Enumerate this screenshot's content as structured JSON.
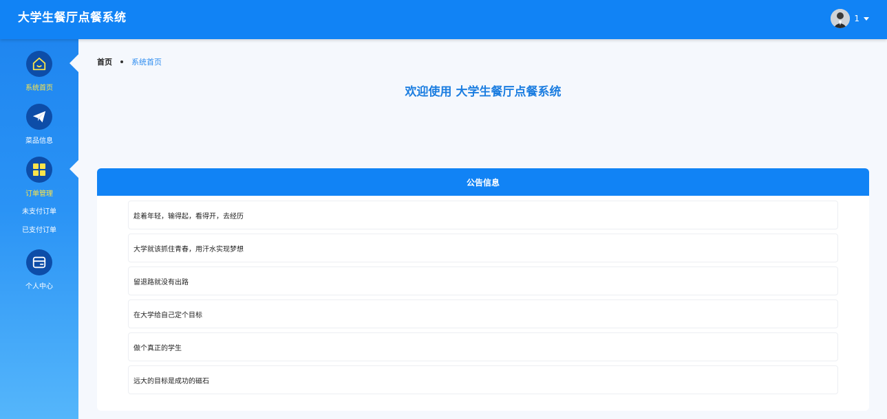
{
  "header": {
    "title": "大学生餐厅点餐系统",
    "user_name": "1"
  },
  "sidebar": {
    "items": [
      {
        "label": "系统首页",
        "icon": "home-icon"
      },
      {
        "label": "菜品信息",
        "icon": "paper-plane-icon"
      },
      {
        "label": "订单管理",
        "icon": "grid-icon"
      },
      {
        "label": "个人中心",
        "icon": "wallet-icon"
      }
    ],
    "sub_items": [
      "未支付订单",
      "已支付订单"
    ]
  },
  "breadcrumb": {
    "home": "首页",
    "current": "系统首页"
  },
  "welcome": "欢迎使用 大学生餐厅点餐系统",
  "notice": {
    "title": "公告信息",
    "items": [
      "趁着年轻，输得起，看得开，去经历",
      "大学就该抓住青春，用汗水实现梦想",
      "留退路就没有出路",
      "在大学给自己定个目标",
      "做个真正的学生",
      "远大的目标是成功的磁石"
    ]
  },
  "colors": {
    "primary": "#1183f5",
    "active_label": "#fbe44a",
    "icon_circle": "#0d4da8",
    "welcome_text": "#1b7de0"
  }
}
